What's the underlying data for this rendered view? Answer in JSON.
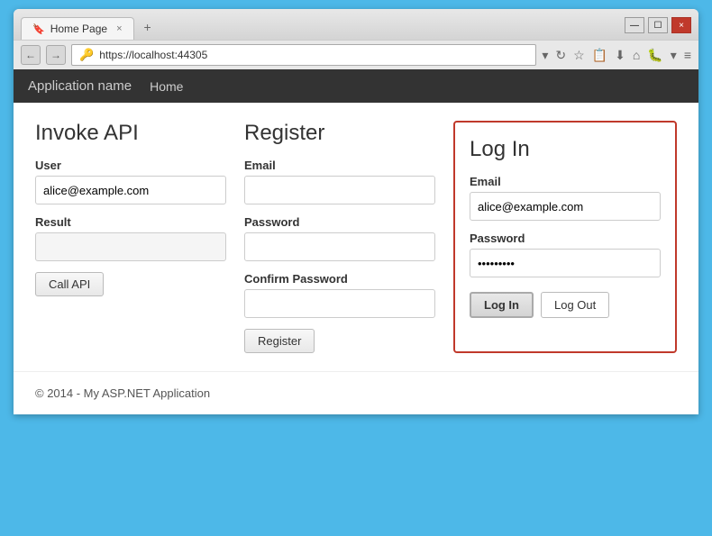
{
  "browser": {
    "tab_title": "Home Page",
    "tab_icon": "🔖",
    "close_label": "×",
    "new_tab_label": "+",
    "address": "https://localhost:44305",
    "back_icon": "←",
    "forward_icon": "→",
    "refresh_icon": "↻",
    "minimize_label": "—",
    "maximize_label": "☐",
    "window_close_label": "×"
  },
  "navbar": {
    "app_name": "Application name",
    "home_link": "Home"
  },
  "invoke_api": {
    "title": "Invoke API",
    "user_label": "User",
    "user_placeholder": "alice@example.com",
    "result_label": "Result",
    "result_value": "",
    "call_api_btn": "Call API"
  },
  "register": {
    "title": "Register",
    "email_label": "Email",
    "email_placeholder": "",
    "password_label": "Password",
    "password_placeholder": "",
    "confirm_password_label": "Confirm Password",
    "confirm_placeholder": "",
    "register_btn": "Register"
  },
  "login": {
    "title": "Log In",
    "email_label": "Email",
    "email_value": "alice@example.com",
    "password_label": "Password",
    "password_value": "••••••••",
    "login_btn": "Log In",
    "logout_btn": "Log Out"
  },
  "footer": {
    "text": "© 2014 - My ASP.NET Application"
  }
}
